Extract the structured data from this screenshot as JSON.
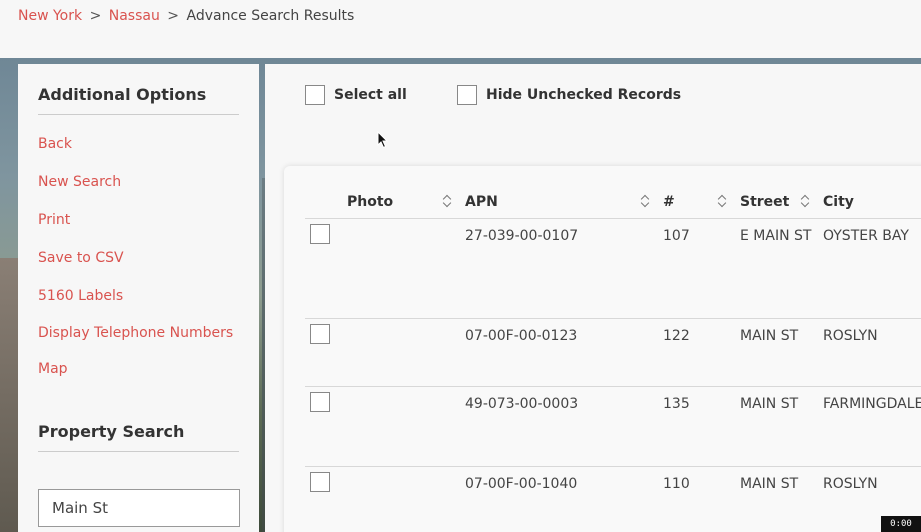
{
  "breadcrumb": {
    "state": "New York",
    "county": "Nassau",
    "current": "Advance Search Results",
    "separator": ">"
  },
  "sidebar": {
    "options_title": "Additional Options",
    "items": [
      "Back",
      "New Search",
      "Print",
      "Save to CSV",
      "5160 Labels",
      "Display Telephone Numbers",
      "Map"
    ],
    "search_title": "Property Search",
    "search_value": "Main St"
  },
  "toolbar": {
    "select_all": "Select all",
    "hide_unchecked": "Hide Unchecked Records"
  },
  "table": {
    "columns": [
      "Photo",
      "APN",
      "#",
      "Street",
      "City"
    ],
    "rows": [
      {
        "apn": "27-039-00-0107",
        "num": "107",
        "street": "E MAIN ST",
        "city": "OYSTER BAY"
      },
      {
        "apn": "07-00F-00-0123",
        "num": "122",
        "street": "MAIN ST",
        "city": "ROSLYN"
      },
      {
        "apn": "49-073-00-0003",
        "num": "135",
        "street": "MAIN ST",
        "city": "FARMINGDALE"
      },
      {
        "apn": "07-00F-00-1040",
        "num": "110",
        "street": "MAIN ST",
        "city": "ROSLYN"
      }
    ]
  },
  "timer": "0:00",
  "colors": {
    "link": "#d9534f"
  }
}
